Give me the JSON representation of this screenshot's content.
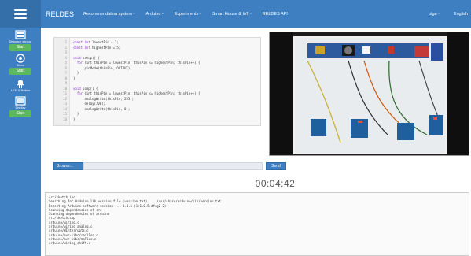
{
  "topbar": {
    "brand": "RELDES",
    "nav": [
      "Recommendation system -",
      "Arduino -",
      "Experiments -",
      "Smart House & IoT -",
      "RELDES API"
    ],
    "user": "olga -",
    "language": "English"
  },
  "sidebar": {
    "tools": [
      {
        "label": "Distance sensor",
        "start": "Start"
      },
      {
        "label": "Servo",
        "start": "Start"
      },
      {
        "label": "LED & Button",
        "start": "Start"
      },
      {
        "label": "Display",
        "start": "Start"
      }
    ]
  },
  "editor": {
    "lines": [
      {
        "num": "1",
        "kw": "const int",
        "rest": " lowestPin = 2;"
      },
      {
        "num": "2",
        "kw": "const int",
        "rest": " highestPin = 5;"
      },
      {
        "num": "3",
        "kw": "",
        "rest": ""
      },
      {
        "num": "4",
        "kw": "void",
        "rest": " setup() {"
      },
      {
        "num": "5",
        "kw": "  for",
        "rest": " (int thisPin = lowestPin; thisPin <= highestPin; thisPin++) {"
      },
      {
        "num": "6",
        "kw": "",
        "rest": "      pinMode(thisPin, OUTPUT);"
      },
      {
        "num": "7",
        "kw": "",
        "rest": "  }"
      },
      {
        "num": "8",
        "kw": "",
        "rest": "}"
      },
      {
        "num": "9",
        "kw": "",
        "rest": ""
      },
      {
        "num": "10",
        "kw": "void",
        "rest": " loop() {"
      },
      {
        "num": "11",
        "kw": "  for",
        "rest": " (int thisPin = lowestPin; thisPin <= highestPin; thisPin++) {"
      },
      {
        "num": "12",
        "kw": "",
        "rest": "      analogWrite(thisPin, 255);"
      },
      {
        "num": "13",
        "kw": "",
        "rest": "      delay(700);"
      },
      {
        "num": "14",
        "kw": "",
        "rest": "      analogWrite(thisPin, 0);"
      },
      {
        "num": "15",
        "kw": "",
        "rest": "  }"
      },
      {
        "num": "16",
        "kw": "",
        "rest": "}"
      }
    ]
  },
  "upload": {
    "browse_label": "Browse...",
    "file_value": "",
    "send_label": "Send"
  },
  "timer": "00:04:42",
  "console": {
    "lines": [
      "src/sketch.ino",
      "Searching for Arduino lib version file (version.txt) ... /usr/share/arduino/lib/version.txt",
      "Detecting Arduino software version ... 1.0.5 (1:1.0.5+dfsg2-2)",
      "Scanning dependencies of src",
      "Scanning dependencies of arduino",
      "src/sketch.cpp",
      "arduino/wiring.c",
      "arduino/wiring_analog.c",
      "arduino/WInterrupts.c",
      "arduino/avr-libc/realloc.c",
      "arduino/avr-libc/malloc.c",
      "arduino/wiring_shift.c"
    ]
  }
}
